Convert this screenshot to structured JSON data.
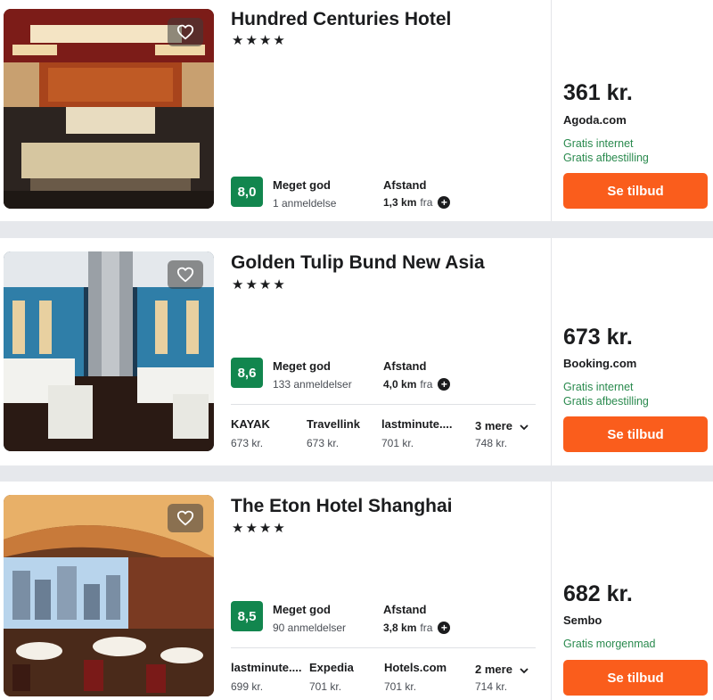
{
  "hotels": [
    {
      "name": "Hundred Centuries Hotel",
      "stars": "★★★★",
      "score": "8,0",
      "rating_label": "Meget god",
      "reviews": "1 anmeldelse",
      "distance_label": "Afstand",
      "distance_value": "1,3 km",
      "distance_suffix": "fra",
      "price": "361 kr.",
      "provider": "Agoda.com",
      "perks": [
        "Gratis internet",
        "Gratis afbestilling"
      ],
      "cta": "Se tilbud"
    },
    {
      "name": "Golden Tulip Bund New Asia",
      "stars": "★★★★",
      "score": "8,6",
      "rating_label": "Meget god",
      "reviews": "133 anmeldelser",
      "distance_label": "Afstand",
      "distance_value": "4,0 km",
      "distance_suffix": "fra",
      "providers": [
        {
          "name": "KAYAK",
          "price": "673 kr."
        },
        {
          "name": "Travellink",
          "price": "673 kr."
        },
        {
          "name": "lastminute....",
          "price": "701 kr."
        }
      ],
      "more_label": "3 mere",
      "more_price": "748 kr.",
      "price": "673 kr.",
      "provider": "Booking.com",
      "perks": [
        "Gratis internet",
        "Gratis afbestilling"
      ],
      "cta": "Se tilbud"
    },
    {
      "name": "The Eton Hotel Shanghai",
      "stars": "★★★★",
      "score": "8,5",
      "rating_label": "Meget god",
      "reviews": "90 anmeldelser",
      "distance_label": "Afstand",
      "distance_value": "3,8 km",
      "distance_suffix": "fra",
      "providers": [
        {
          "name": "lastminute....",
          "price": "699 kr."
        },
        {
          "name": "Expedia",
          "price": "701 kr."
        },
        {
          "name": "Hotels.com",
          "price": "701 kr."
        }
      ],
      "more_label": "2 mere",
      "more_price": "714 kr.",
      "price": "682 kr.",
      "provider": "Sembo",
      "perks": [
        "Gratis morgenmad"
      ],
      "cta": "Se tilbud"
    }
  ],
  "colors": {
    "score_bg": "#12864e",
    "cta_bg": "#fa5d1c",
    "perk": "#2a8a4e",
    "page_bg": "#e6e8ec"
  },
  "icons": {
    "favorite": "heart-icon",
    "distance_info": "plus-circle-icon",
    "more": "chevron-down-icon"
  }
}
